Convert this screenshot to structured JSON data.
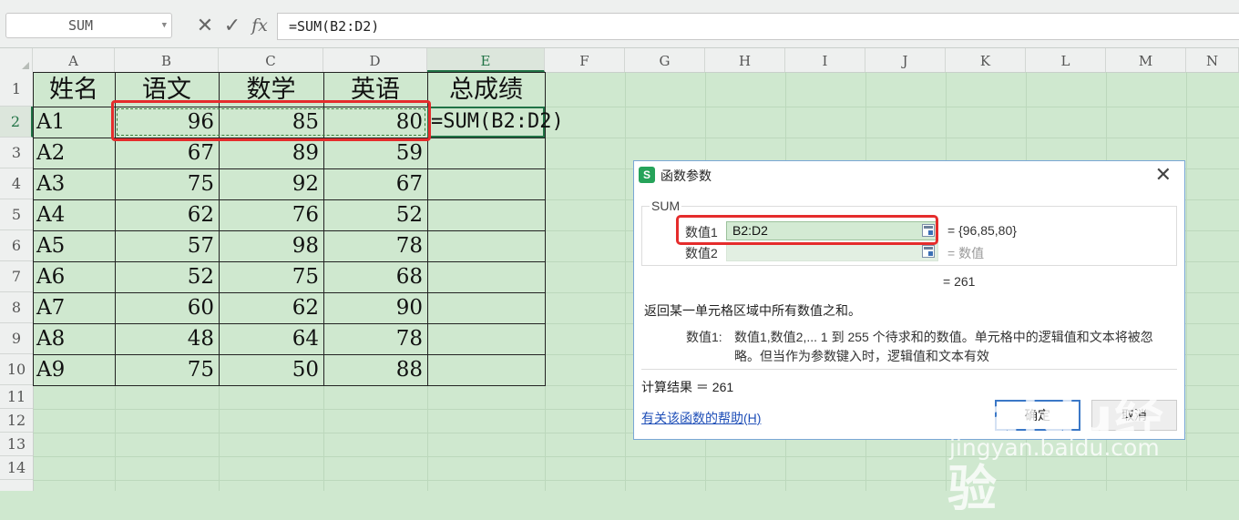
{
  "formula_bar": {
    "name_box": "SUM",
    "cancel_icon": "✕",
    "confirm_icon": "✓",
    "fx_icon": "fx",
    "formula": "=SUM(B2:D2)"
  },
  "columns": [
    "A",
    "B",
    "C",
    "D",
    "E",
    "F",
    "G",
    "H",
    "I",
    "J",
    "K",
    "L",
    "M",
    "N"
  ],
  "rows": [
    "1",
    "2",
    "3",
    "4",
    "5",
    "6",
    "7",
    "8",
    "9",
    "10",
    "11",
    "12",
    "13",
    "14"
  ],
  "table": {
    "headers": [
      "姓名",
      "语文",
      "数学",
      "英语",
      "总成绩"
    ],
    "rows": [
      [
        "A1",
        "96",
        "85",
        "80"
      ],
      [
        "A2",
        "67",
        "89",
        "59"
      ],
      [
        "A3",
        "75",
        "92",
        "67"
      ],
      [
        "A4",
        "62",
        "76",
        "52"
      ],
      [
        "A5",
        "57",
        "98",
        "78"
      ],
      [
        "A6",
        "52",
        "75",
        "68"
      ],
      [
        "A7",
        "60",
        "62",
        "90"
      ],
      [
        "A8",
        "48",
        "64",
        "78"
      ],
      [
        "A9",
        "75",
        "50",
        "88"
      ]
    ],
    "e2_formula": "=SUM(B2:D2)"
  },
  "dialog": {
    "title": "函数参数",
    "icon_letter": "S",
    "close": "✕",
    "function_name": "SUM",
    "arg1_label": "数值1",
    "arg1_value": "B2:D2",
    "arg1_result": "= {96,85,80}",
    "arg2_label": "数值2",
    "arg2_value": "",
    "arg2_result": "= 数值",
    "result_top": "= 261",
    "description": "返回某一单元格区域中所有数值之和。",
    "param_name": "数值1:",
    "param_desc": "数值1,数值2,... 1 到 255 个待求和的数值。单元格中的逻辑值和文本将被忽略。但当作为参数键入时，逻辑值和文本有效",
    "calc_result": "计算结果 ＝ 261",
    "help_link": "有关该函数的帮助(H)",
    "ok": "确定",
    "cancel": "取消"
  },
  "watermark": {
    "brand": "Baidu经验",
    "url": "jingyan.baidu.com"
  },
  "colors": {
    "sheet_bg": "#cfe8cf",
    "highlight": "#e52c2c",
    "accent": "#217346"
  }
}
